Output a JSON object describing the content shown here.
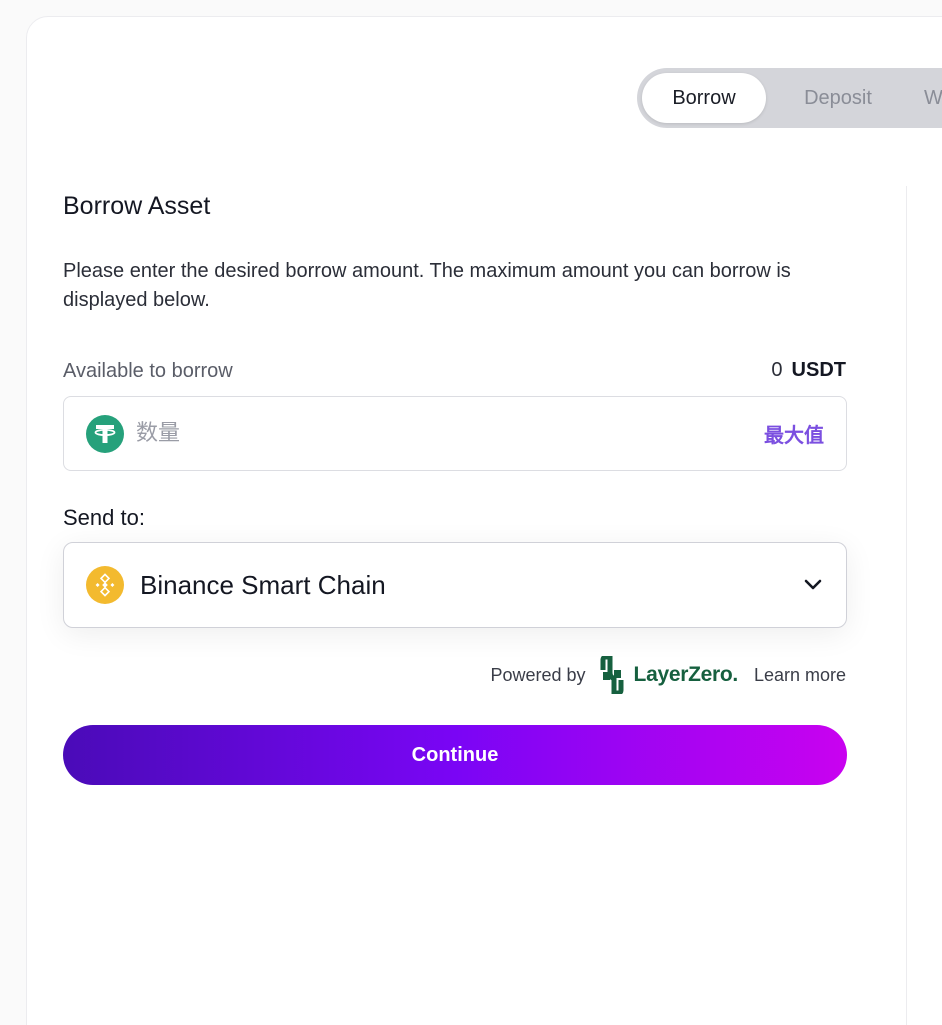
{
  "tabs": [
    {
      "label": "Borrow",
      "active": true
    },
    {
      "label": "Deposit",
      "active": false
    },
    {
      "label": "W",
      "active": false
    }
  ],
  "borrow": {
    "title": "Borrow Asset",
    "description": "Please enter the desired borrow amount. The maximum amount you can borrow is displayed below.",
    "available_label": "Available to borrow",
    "available_amount": "0",
    "available_currency": "USDT",
    "amount_placeholder": "数量",
    "max_label": "最大值",
    "token_icon": "usdt-icon",
    "send_to_label": "Send to:",
    "chain_name": "Binance Smart Chain",
    "chain_icon": "bnb-icon",
    "powered_by": "Powered by",
    "provider_name": "LayerZero.",
    "learn_more": "Learn more",
    "continue_label": "Continue"
  },
  "colors": {
    "accent_purple": "#7b4fe0",
    "usdt_green": "#26a17b",
    "bnb_yellow": "#f3ba2f",
    "layerzero_green": "#16603f",
    "gradient_start": "#4a0bb8",
    "gradient_mid": "#7a05f5",
    "gradient_end": "#c902f0"
  }
}
